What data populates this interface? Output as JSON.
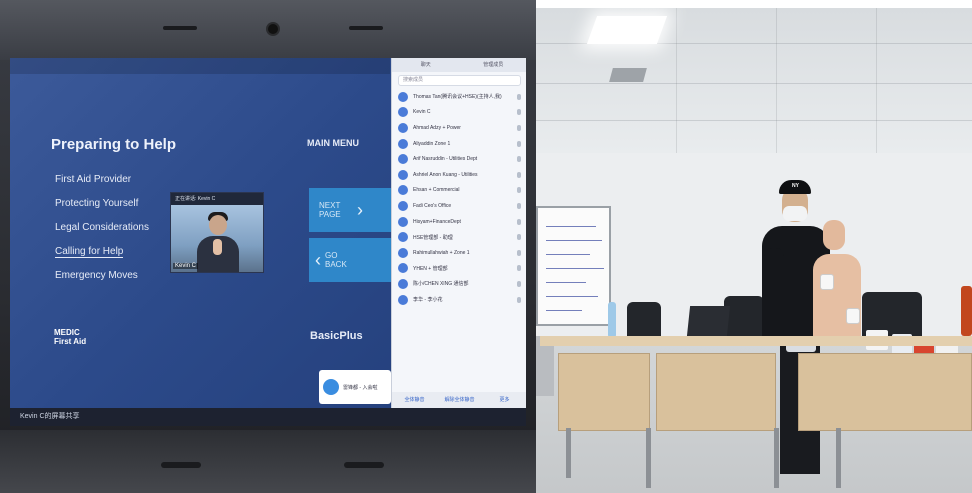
{
  "left_photo": {
    "screen": {
      "course_title": "Preparing to Help",
      "menu_items": [
        "First Aid Provider",
        "Protecting Yourself",
        "Legal Considerations",
        "Calling for Help",
        "Emergency Moves"
      ],
      "main_menu_label": "MAIN MENU",
      "next_page_label": "NEXT PAGE",
      "go_back_label": "GO BACK",
      "logo_text": "MEDIC\nFirst Aid",
      "brand_text": "BasicPlus",
      "video_tile": {
        "header": "正在讲话: Kevin C",
        "name_tag": "Kevin C"
      },
      "participants_panel": {
        "tabs": [
          "聊天",
          "管理成员"
        ],
        "search_placeholder": "搜索成员",
        "participants": [
          "Thomas Tan(腾讯会议+HSE)(主持人,我)",
          "Kevin C",
          "Ahmad Adzy + Power",
          "Aliyaddin Zone 1",
          "Arif Nasruddin - Utilities Dept",
          "Ashriel Anon Kuang - Utilities",
          "Ehsan + Commercial",
          "Fadi Ceo's Office",
          "Hisyam+FinanceDept",
          "HSE管理部 - 助理",
          "Rahimullahwiah + Zone 1",
          "YHEN + 管理部",
          "陈小/CHEN XING 通信部",
          "李华 - 李小花"
        ],
        "bottom_actions": [
          "全体静音",
          "解除全体静音",
          "更多"
        ]
      },
      "notification": "雷锋都 - 入会啦",
      "share_bar": "Kevin C的屏幕共享"
    }
  },
  "right_photo": {
    "cap_logo": "NY"
  }
}
